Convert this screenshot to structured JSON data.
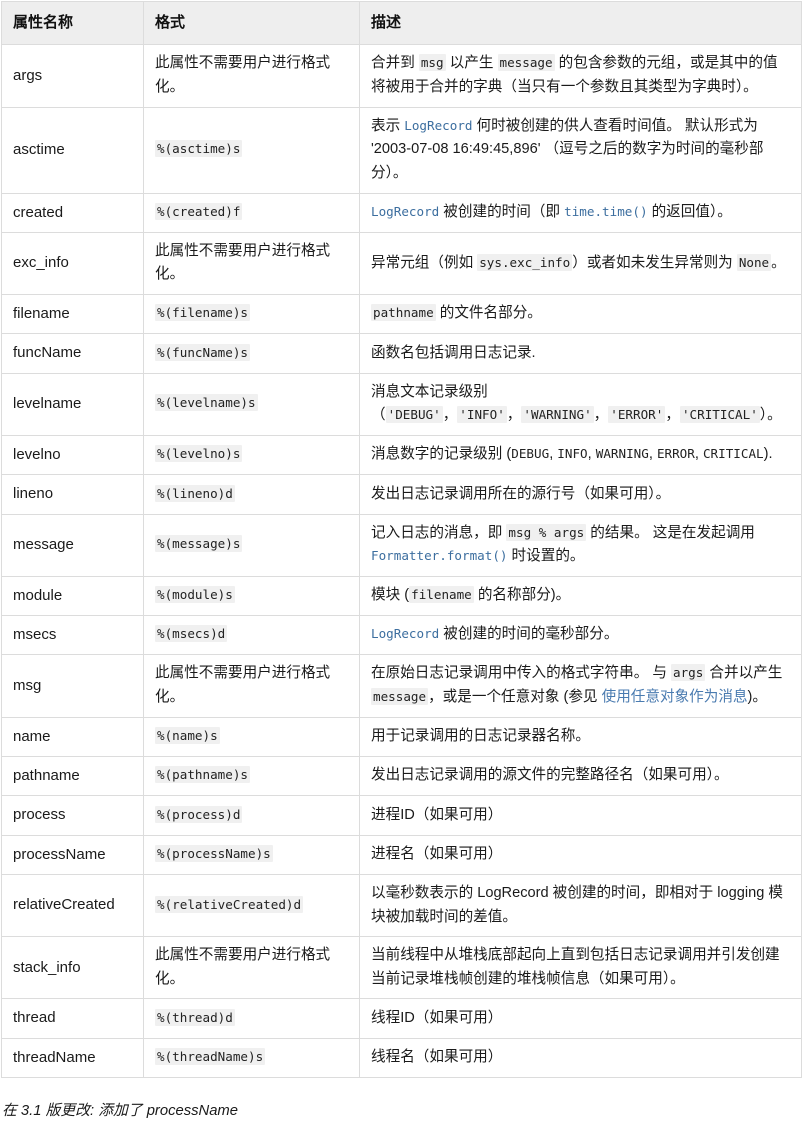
{
  "table": {
    "headers": [
      "属性名称",
      "格式",
      "描述"
    ],
    "no_format_note": "此属性不需要用户进行格式化。",
    "rows": [
      {
        "name": "args",
        "format": "此属性不需要用户进行格式化。",
        "format_is_code": false,
        "desc_parts": [
          {
            "t": "text",
            "v": "合并到 "
          },
          {
            "t": "code",
            "v": "msg"
          },
          {
            "t": "text",
            "v": " 以产生 "
          },
          {
            "t": "code",
            "v": "message"
          },
          {
            "t": "text",
            "v": " 的包含参数的元组，或是其中的值将被用于合并的字典（当只有一个参数且其类型为字典时）。"
          }
        ]
      },
      {
        "name": "asctime",
        "format": "%(asctime)s",
        "format_is_code": true,
        "desc_parts": [
          {
            "t": "text",
            "v": "表示 "
          },
          {
            "t": "link",
            "v": "LogRecord"
          },
          {
            "t": "text",
            "v": " 何时被创建的供人查看时间值。 默认形式为 '2003-07-08 16:49:45,896' （逗号之后的数字为时间的毫秒部分）。"
          }
        ]
      },
      {
        "name": "created",
        "format": "%(created)f",
        "format_is_code": true,
        "desc_parts": [
          {
            "t": "link",
            "v": "LogRecord"
          },
          {
            "t": "text",
            "v": " 被创建的时间（即 "
          },
          {
            "t": "link",
            "v": "time.time()"
          },
          {
            "t": "text",
            "v": " 的返回值）。"
          }
        ]
      },
      {
        "name": "exc_info",
        "format": "此属性不需要用户进行格式化。",
        "format_is_code": false,
        "desc_parts": [
          {
            "t": "text",
            "v": "异常元组（例如 "
          },
          {
            "t": "code",
            "v": "sys.exc_info"
          },
          {
            "t": "text",
            "v": "）或者如未发生异常则为 "
          },
          {
            "t": "code",
            "v": "None"
          },
          {
            "t": "text",
            "v": "。"
          }
        ]
      },
      {
        "name": "filename",
        "format": "%(filename)s",
        "format_is_code": true,
        "desc_parts": [
          {
            "t": "code",
            "v": "pathname"
          },
          {
            "t": "text",
            "v": " 的文件名部分。"
          }
        ]
      },
      {
        "name": "funcName",
        "format": "%(funcName)s",
        "format_is_code": true,
        "desc_parts": [
          {
            "t": "text",
            "v": "函数名包括调用日志记录."
          }
        ]
      },
      {
        "name": "levelname",
        "format": "%(levelname)s",
        "format_is_code": true,
        "desc_parts": [
          {
            "t": "text",
            "v": "消息文本记录级别 （"
          },
          {
            "t": "code",
            "v": "'DEBUG'"
          },
          {
            "t": "text",
            "v": "，"
          },
          {
            "t": "code",
            "v": "'INFO'"
          },
          {
            "t": "text",
            "v": "，"
          },
          {
            "t": "code",
            "v": "'WARNING'"
          },
          {
            "t": "text",
            "v": "，"
          },
          {
            "t": "code",
            "v": "'ERROR'"
          },
          {
            "t": "text",
            "v": "，"
          },
          {
            "t": "code",
            "v": "'CRITICAL'"
          },
          {
            "t": "text",
            "v": "）。"
          }
        ]
      },
      {
        "name": "levelno",
        "format": "%(levelno)s",
        "format_is_code": true,
        "desc_parts": [
          {
            "t": "text",
            "v": "消息数字的记录级别 ("
          },
          {
            "t": "mono",
            "v": "DEBUG"
          },
          {
            "t": "text",
            "v": ", "
          },
          {
            "t": "mono",
            "v": "INFO"
          },
          {
            "t": "text",
            "v": ", "
          },
          {
            "t": "mono",
            "v": "WARNING"
          },
          {
            "t": "text",
            "v": ", "
          },
          {
            "t": "mono",
            "v": "ERROR"
          },
          {
            "t": "text",
            "v": ", "
          },
          {
            "t": "mono",
            "v": "CRITICAL"
          },
          {
            "t": "text",
            "v": ")."
          }
        ]
      },
      {
        "name": "lineno",
        "format": "%(lineno)d",
        "format_is_code": true,
        "desc_parts": [
          {
            "t": "text",
            "v": "发出日志记录调用所在的源行号（如果可用）。"
          }
        ]
      },
      {
        "name": "message",
        "format": "%(message)s",
        "format_is_code": true,
        "desc_parts": [
          {
            "t": "text",
            "v": "记入日志的消息，即 "
          },
          {
            "t": "code",
            "v": "msg % args"
          },
          {
            "t": "text",
            "v": " 的结果。 这是在发起调用 "
          },
          {
            "t": "link",
            "v": "Formatter.format()"
          },
          {
            "t": "text",
            "v": " 时设置的。"
          }
        ]
      },
      {
        "name": "module",
        "format": "%(module)s",
        "format_is_code": true,
        "desc_parts": [
          {
            "t": "text",
            "v": "模块 ("
          },
          {
            "t": "code",
            "v": "filename"
          },
          {
            "t": "text",
            "v": " 的名称部分)。"
          }
        ]
      },
      {
        "name": "msecs",
        "format": "%(msecs)d",
        "format_is_code": true,
        "desc_parts": [
          {
            "t": "link",
            "v": "LogRecord"
          },
          {
            "t": "text",
            "v": " 被创建的时间的毫秒部分。"
          }
        ]
      },
      {
        "name": "msg",
        "format": "此属性不需要用户进行格式化。",
        "format_is_code": false,
        "desc_parts": [
          {
            "t": "text",
            "v": "在原始日志记录调用中传入的格式字符串。 与 "
          },
          {
            "t": "code",
            "v": "args"
          },
          {
            "t": "text",
            "v": " 合并以产生 "
          },
          {
            "t": "code",
            "v": "message"
          },
          {
            "t": "text",
            "v": "，或是一个任意对象 (参见 "
          },
          {
            "t": "doclink",
            "v": "使用任意对象作为消息"
          },
          {
            "t": "text",
            "v": ")。"
          }
        ]
      },
      {
        "name": "name",
        "format": "%(name)s",
        "format_is_code": true,
        "desc_parts": [
          {
            "t": "text",
            "v": "用于记录调用的日志记录器名称。"
          }
        ]
      },
      {
        "name": "pathname",
        "format": "%(pathname)s",
        "format_is_code": true,
        "desc_parts": [
          {
            "t": "text",
            "v": "发出日志记录调用的源文件的完整路径名（如果可用）。"
          }
        ]
      },
      {
        "name": "process",
        "format": "%(process)d",
        "format_is_code": true,
        "desc_parts": [
          {
            "t": "text",
            "v": "进程ID（如果可用）"
          }
        ]
      },
      {
        "name": "processName",
        "format": "%(processName)s",
        "format_is_code": true,
        "desc_parts": [
          {
            "t": "text",
            "v": "进程名（如果可用）"
          }
        ]
      },
      {
        "name": "relativeCreated",
        "format": "%(relativeCreated)d",
        "format_is_code": true,
        "desc_parts": [
          {
            "t": "text",
            "v": "以毫秒数表示的 LogRecord 被创建的时间，即相对于 logging 模块被加载时间的差值。"
          }
        ]
      },
      {
        "name": "stack_info",
        "format": "此属性不需要用户进行格式化。",
        "format_is_code": false,
        "desc_parts": [
          {
            "t": "text",
            "v": "当前线程中从堆栈底部起向上直到包括日志记录调用并引发创建当前记录堆栈帧创建的堆栈帧信息（如果可用）。"
          }
        ]
      },
      {
        "name": "thread",
        "format": "%(thread)d",
        "format_is_code": true,
        "desc_parts": [
          {
            "t": "text",
            "v": "线程ID（如果可用）"
          }
        ]
      },
      {
        "name": "threadName",
        "format": "%(threadName)s",
        "format_is_code": true,
        "desc_parts": [
          {
            "t": "text",
            "v": "线程名（如果可用）"
          }
        ]
      }
    ]
  },
  "version_note": {
    "label": "在 3.1 版更改:",
    "text": " 添加了 processName"
  },
  "colors": {
    "link": "#4a7bb0",
    "code_bg": "#f0f0f0",
    "header_bg": "#eeeeee",
    "border": "#dcdcdc"
  }
}
